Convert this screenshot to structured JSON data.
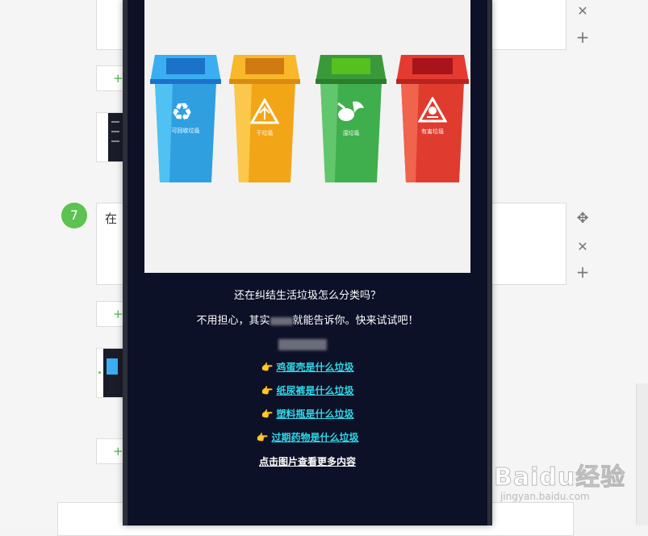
{
  "editor": {
    "step_number": "7",
    "step_text": "在",
    "add_label": "+",
    "bottom_box_text": ""
  },
  "phone": {
    "bins": [
      {
        "label": "可回收垃圾",
        "color": "#2f9fe0",
        "lid": "#3aaef0",
        "icon": "recycle-icon"
      },
      {
        "label": "干垃圾",
        "color": "#f2a516",
        "lid": "#f8b82a",
        "icon": "dry-waste-icon"
      },
      {
        "label": "湿垃圾",
        "color": "#3fae4c",
        "lid": "#3a9a3a",
        "icon": "wet-waste-icon"
      },
      {
        "label": "有害垃圾",
        "color": "#e03b2f",
        "lid": "#e43a30",
        "icon": "hazard-icon"
      }
    ],
    "line1": "还在纠结生活垃圾怎么分类吗？",
    "line2a": "不用担心，其实",
    "line2b": "就能告诉你。快来试试吧！",
    "links": [
      {
        "hand": "👉",
        "text": "鸡蛋壳是什么垃圾"
      },
      {
        "hand": "👉",
        "text": "纸尿裤是什么垃圾"
      },
      {
        "hand": "👉",
        "text": "塑料瓶是什么垃圾"
      },
      {
        "hand": "👉",
        "text": "过期药物是什么垃圾"
      }
    ],
    "more": "点击图片查看更多内容"
  },
  "watermark": {
    "logo": "Baidu经验",
    "url": "jingyan.baidu.com"
  },
  "colors": {
    "accent_green": "#5cc252",
    "link": "#2fd8e8",
    "phone_bg": "#0d1127"
  }
}
